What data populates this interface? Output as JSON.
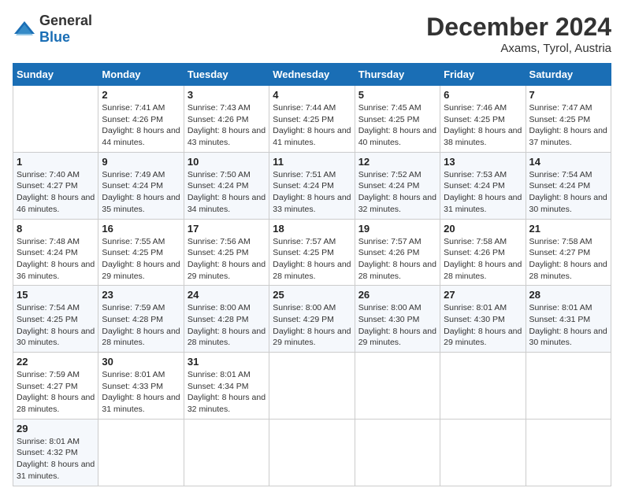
{
  "header": {
    "logo_general": "General",
    "logo_blue": "Blue",
    "month_year": "December 2024",
    "location": "Axams, Tyrol, Austria"
  },
  "calendar": {
    "days_of_week": [
      "Sunday",
      "Monday",
      "Tuesday",
      "Wednesday",
      "Thursday",
      "Friday",
      "Saturday"
    ],
    "weeks": [
      [
        {
          "day": "",
          "info": ""
        },
        {
          "day": "2",
          "info": "Sunrise: 7:41 AM\nSunset: 4:26 PM\nDaylight: 8 hours and 44 minutes."
        },
        {
          "day": "3",
          "info": "Sunrise: 7:43 AM\nSunset: 4:26 PM\nDaylight: 8 hours and 43 minutes."
        },
        {
          "day": "4",
          "info": "Sunrise: 7:44 AM\nSunset: 4:25 PM\nDaylight: 8 hours and 41 minutes."
        },
        {
          "day": "5",
          "info": "Sunrise: 7:45 AM\nSunset: 4:25 PM\nDaylight: 8 hours and 40 minutes."
        },
        {
          "day": "6",
          "info": "Sunrise: 7:46 AM\nSunset: 4:25 PM\nDaylight: 8 hours and 38 minutes."
        },
        {
          "day": "7",
          "info": "Sunrise: 7:47 AM\nSunset: 4:25 PM\nDaylight: 8 hours and 37 minutes."
        }
      ],
      [
        {
          "day": "1",
          "info": "Sunrise: 7:40 AM\nSunset: 4:27 PM\nDaylight: 8 hours and 46 minutes."
        },
        {
          "day": "9",
          "info": "Sunrise: 7:49 AM\nSunset: 4:24 PM\nDaylight: 8 hours and 35 minutes."
        },
        {
          "day": "10",
          "info": "Sunrise: 7:50 AM\nSunset: 4:24 PM\nDaylight: 8 hours and 34 minutes."
        },
        {
          "day": "11",
          "info": "Sunrise: 7:51 AM\nSunset: 4:24 PM\nDaylight: 8 hours and 33 minutes."
        },
        {
          "day": "12",
          "info": "Sunrise: 7:52 AM\nSunset: 4:24 PM\nDaylight: 8 hours and 32 minutes."
        },
        {
          "day": "13",
          "info": "Sunrise: 7:53 AM\nSunset: 4:24 PM\nDaylight: 8 hours and 31 minutes."
        },
        {
          "day": "14",
          "info": "Sunrise: 7:54 AM\nSunset: 4:24 PM\nDaylight: 8 hours and 30 minutes."
        }
      ],
      [
        {
          "day": "8",
          "info": "Sunrise: 7:48 AM\nSunset: 4:24 PM\nDaylight: 8 hours and 36 minutes."
        },
        {
          "day": "16",
          "info": "Sunrise: 7:55 AM\nSunset: 4:25 PM\nDaylight: 8 hours and 29 minutes."
        },
        {
          "day": "17",
          "info": "Sunrise: 7:56 AM\nSunset: 4:25 PM\nDaylight: 8 hours and 29 minutes."
        },
        {
          "day": "18",
          "info": "Sunrise: 7:57 AM\nSunset: 4:25 PM\nDaylight: 8 hours and 28 minutes."
        },
        {
          "day": "19",
          "info": "Sunrise: 7:57 AM\nSunset: 4:26 PM\nDaylight: 8 hours and 28 minutes."
        },
        {
          "day": "20",
          "info": "Sunrise: 7:58 AM\nSunset: 4:26 PM\nDaylight: 8 hours and 28 minutes."
        },
        {
          "day": "21",
          "info": "Sunrise: 7:58 AM\nSunset: 4:27 PM\nDaylight: 8 hours and 28 minutes."
        }
      ],
      [
        {
          "day": "15",
          "info": "Sunrise: 7:54 AM\nSunset: 4:25 PM\nDaylight: 8 hours and 30 minutes."
        },
        {
          "day": "23",
          "info": "Sunrise: 7:59 AM\nSunset: 4:28 PM\nDaylight: 8 hours and 28 minutes."
        },
        {
          "day": "24",
          "info": "Sunrise: 8:00 AM\nSunset: 4:28 PM\nDaylight: 8 hours and 28 minutes."
        },
        {
          "day": "25",
          "info": "Sunrise: 8:00 AM\nSunset: 4:29 PM\nDaylight: 8 hours and 29 minutes."
        },
        {
          "day": "26",
          "info": "Sunrise: 8:00 AM\nSunset: 4:30 PM\nDaylight: 8 hours and 29 minutes."
        },
        {
          "day": "27",
          "info": "Sunrise: 8:01 AM\nSunset: 4:30 PM\nDaylight: 8 hours and 29 minutes."
        },
        {
          "day": "28",
          "info": "Sunrise: 8:01 AM\nSunset: 4:31 PM\nDaylight: 8 hours and 30 minutes."
        }
      ],
      [
        {
          "day": "22",
          "info": "Sunrise: 7:59 AM\nSunset: 4:27 PM\nDaylight: 8 hours and 28 minutes."
        },
        {
          "day": "30",
          "info": "Sunrise: 8:01 AM\nSunset: 4:33 PM\nDaylight: 8 hours and 31 minutes."
        },
        {
          "day": "31",
          "info": "Sunrise: 8:01 AM\nSunset: 4:34 PM\nDaylight: 8 hours and 32 minutes."
        },
        {
          "day": "",
          "info": ""
        },
        {
          "day": "",
          "info": ""
        },
        {
          "day": "",
          "info": ""
        },
        {
          "day": ""
        }
      ],
      [
        {
          "day": "29",
          "info": "Sunrise: 8:01 AM\nSunset: 4:32 PM\nDaylight: 8 hours and 31 minutes."
        },
        {
          "day": "",
          "info": ""
        },
        {
          "day": "",
          "info": ""
        },
        {
          "day": "",
          "info": ""
        },
        {
          "day": "",
          "info": ""
        },
        {
          "day": "",
          "info": ""
        },
        {
          "day": "",
          "info": ""
        }
      ]
    ]
  }
}
